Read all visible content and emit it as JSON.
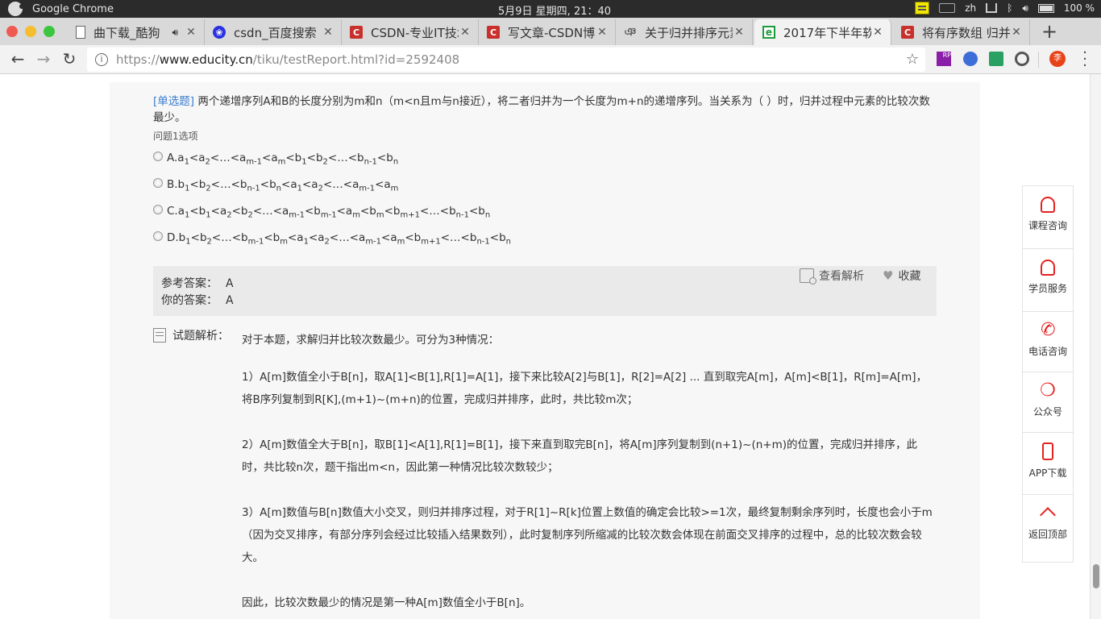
{
  "os": {
    "app_name": "Google Chrome",
    "clock": "5月9日 星期四, 21：40",
    "lang": "zh",
    "battery": "100 %"
  },
  "tabs": [
    {
      "label": "曲下载_酷狗",
      "icon": "document-icon"
    },
    {
      "label": "csdn_百度搜索",
      "icon": "baidu-icon"
    },
    {
      "label": "CSDN-专业IT技术",
      "icon": "csdn-icon"
    },
    {
      "label": "写文章-CSDN博客",
      "icon": "csdn-icon"
    },
    {
      "label": "关于归并排序元素",
      "icon": "squiggle-icon"
    },
    {
      "label": "2017年下半年软",
      "icon": "educity-icon"
    },
    {
      "label": "将有序数组 归并",
      "icon": "csdn-icon"
    }
  ],
  "toolbar": {
    "url_scheme": "https://",
    "url_host": "www.educity.cn",
    "url_path": "/tiku/testReport.html?id=2592408",
    "avatar": "李"
  },
  "question": {
    "type": "[单选题]",
    "text": " 两个递增序列A和B的长度分别为m和n（m<n且m与n接近），将二者归并为一个长度为m+n的递增序列。当关系为（ ）时，归并过程中元素的比较次数最少。",
    "sub": "问题1选项",
    "options": [
      "A.a<sub>1</sub>&lt;a<sub>2</sub>&lt;…&lt;a<sub>m-1</sub>&lt;a<sub>m</sub>&lt;b<sub>1</sub>&lt;b<sub>2</sub>&lt;…&lt;b<sub>n-1</sub>&lt;b<sub>n</sub>",
      "B.b<sub>1</sub>&lt;b<sub>2</sub>&lt;…&lt;b<sub>n-1</sub>&lt;b<sub>n</sub>&lt;a<sub>1</sub>&lt;a<sub>2</sub>&lt;…&lt;a<sub>m-1</sub>&lt;a<sub>m</sub>",
      "C.a<sub>1</sub>&lt;b<sub>1</sub>&lt;a<sub>2</sub>&lt;b<sub>2</sub>&lt;…&lt;a<sub>m-1</sub>&lt;b<sub>m-1</sub>&lt;a<sub>m</sub>&lt;b<sub>m</sub>&lt;b<sub>m+1</sub>&lt;…&lt;b<sub>n-1</sub>&lt;b<sub>n</sub>",
      "D.b<sub>1</sub>&lt;b<sub>2</sub>&lt;…&lt;b<sub>m-1</sub>&lt;b<sub>m</sub>&lt;a<sub>1</sub>&lt;a<sub>2</sub>&lt;…&lt;a<sub>m-1</sub>&lt;a<sub>m</sub>&lt;b<sub>m+1</sub>&lt;…&lt;b<sub>n-1</sub>&lt;b<sub>n</sub>"
    ]
  },
  "answer": {
    "ref_label": "参考答案：",
    "ref_value": "A",
    "yours_label": "你的答案：",
    "yours_value": "A",
    "view_analysis": "查看解析",
    "favorite": "收藏"
  },
  "analysis": {
    "heading": "试题解析：",
    "intro": "对于本题，求解归并比较次数最少。可分为3种情况：",
    "paras": [
      "1）A[m]数值全小于B[n]，取A[1]<B[1],R[1]=A[1]，接下来比较A[2]与B[1]，R[2]=A[2] ... 直到取完A[m]，A[m]<B[1]，R[m]=A[m]，将B序列复制到R[K],(m+1)~(m+n)的位置，完成归并排序，此时，共比较m次；",
      "2）A[m]数值全大于B[n]，取B[1]<A[1],R[1]=B[1]，接下来直到取完B[n]，将A[m]序列复制到(n+1)~(n+m)的位置，完成归并排序，此时，共比较n次，题干指出m<n，因此第一种情况比较次数较少；",
      "3）A[m]数值与B[n]数值大小交叉，则归并排序过程，对于R[1]~R[k]位置上数值的确定会比较>=1次，最终复制剩余序列时，长度也会小于m（因为交叉排序，有部分序列会经过比较插入结果数列），此时复制序列所缩减的比较次数会体现在前面交叉排序的过程中，总的比较次数会较大。",
      "因此，比较次数最少的情况是第一种A[m]数值全小于B[n]。"
    ]
  },
  "sidebar": [
    {
      "label": "课程咨询",
      "icon": "qq-icon"
    },
    {
      "label": "学员服务",
      "icon": "qq-icon"
    },
    {
      "label": "电话咨询",
      "icon": "phone-icon"
    },
    {
      "label": "公众号",
      "icon": "wechat-icon"
    },
    {
      "label": "APP下载",
      "icon": "mobile-icon"
    },
    {
      "label": "返回顶部",
      "icon": "arrow-up-icon"
    }
  ]
}
